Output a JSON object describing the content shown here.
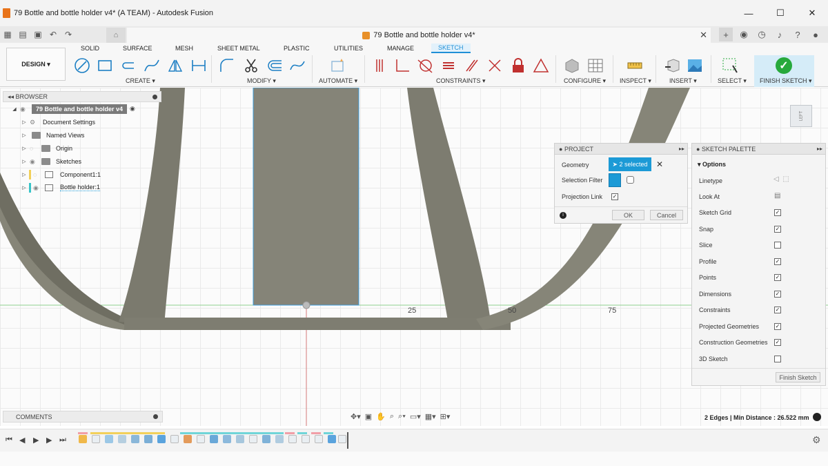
{
  "window": {
    "title": "79 Bottle and bottle holder v4* (A TEAM) - Autodesk Fusion",
    "controls": [
      "—",
      "☐",
      "✕"
    ]
  },
  "doc_tab": {
    "title": "79 Bottle and bottle holder v4*",
    "close": "✕"
  },
  "ribbon": {
    "workspace": "DESIGN",
    "tabs": [
      "SOLID",
      "SURFACE",
      "MESH",
      "SHEET METAL",
      "PLASTIC",
      "UTILITIES",
      "MANAGE",
      "SKETCH"
    ],
    "active_tab": "SKETCH",
    "groups": {
      "create": "CREATE",
      "modify": "MODIFY",
      "automate": "AUTOMATE",
      "constraints": "CONSTRAINTS",
      "configure": "CONFIGURE",
      "inspect": "INSPECT",
      "insert": "INSERT",
      "select": "SELECT",
      "finish": "FINISH SKETCH"
    }
  },
  "browser": {
    "header": "BROWSER",
    "root": "79 Bottle and bottle holder v4",
    "items": [
      {
        "label": "Document Settings",
        "icon": "gear-icon"
      },
      {
        "label": "Named Views",
        "icon": "folder-icon"
      },
      {
        "label": "Origin",
        "icon": "folder-icon"
      },
      {
        "label": "Sketches",
        "icon": "folder-icon"
      },
      {
        "label": "Component1:1",
        "icon": "component-icon"
      },
      {
        "label": "Bottle holder:1",
        "icon": "component-icon"
      }
    ]
  },
  "project_dialog": {
    "title": "PROJECT",
    "geometry_label": "Geometry",
    "geometry_value": "2 selected",
    "selection_filter_label": "Selection Filter",
    "projection_link_label": "Projection Link",
    "projection_link_checked": true,
    "ok": "OK",
    "cancel": "Cancel"
  },
  "sketch_palette": {
    "title": "SKETCH PALETTE",
    "section": "Options",
    "options": [
      {
        "label": "Linetype",
        "kind": "icons"
      },
      {
        "label": "Look At",
        "kind": "icon"
      },
      {
        "label": "Sketch Grid",
        "checked": true
      },
      {
        "label": "Snap",
        "checked": true
      },
      {
        "label": "Slice",
        "checked": false
      },
      {
        "label": "Profile",
        "checked": true
      },
      {
        "label": "Points",
        "checked": true
      },
      {
        "label": "Dimensions",
        "checked": true
      },
      {
        "label": "Constraints",
        "checked": true
      },
      {
        "label": "Projected Geometries",
        "checked": true
      },
      {
        "label": "Construction Geometries",
        "checked": true
      },
      {
        "label": "3D Sketch",
        "checked": false
      }
    ],
    "finish_button": "Finish Sketch"
  },
  "viewport": {
    "axis_labels": [
      "25",
      "50",
      "75"
    ],
    "viewcube_face": "LEFT",
    "status": "2 Edges | Min Distance : 26.522 mm"
  },
  "comments": {
    "header": "COMMENTS"
  },
  "colors": {
    "accent": "#1c9ad6",
    "finish_green": "#27a93c",
    "model_gray": "#7d7c72",
    "grid": "#eaeaea"
  }
}
